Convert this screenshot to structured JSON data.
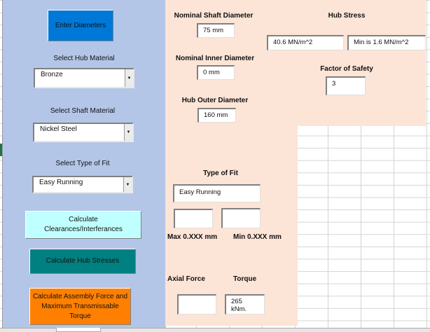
{
  "left_panel": {
    "enter_diameters": "Enter Diameters",
    "hub_material_label": "Select Hub Material",
    "hub_material_value": "Bronze",
    "shaft_material_label": "Select Shaft Material",
    "shaft_material_value": "Nickel Steel",
    "fit_label": "Select Type of Fit",
    "fit_value": "Easy Running",
    "calc_clearances": "Calculate Clearances/Interferances",
    "calc_hub_stresses": "Calculate Hub Stresses",
    "calc_assembly": "Calculate Assembly Force and Maximum Transmissable Torque"
  },
  "results": {
    "shaft_diameter_label": "Nominal Shaft Diameter",
    "shaft_diameter_value": "75 mm",
    "inner_diameter_label": "Nominal Inner Diameter",
    "inner_diameter_value": "0 mm",
    "outer_diameter_label": "Hub Outer Diameter",
    "outer_diameter_value": "160 mm",
    "hub_stress_label": "Hub Stress",
    "hub_stress_value": "40.6 MN/m^2",
    "hub_stress_min": "Min is  1.6 MN/m^2",
    "fos_label": "Factor of Safety",
    "fos_value": "3",
    "fit_label": "Type of Fit",
    "fit_value": "Easy Running",
    "max_label": "Max 0.XXX mm",
    "min_label": "Min 0.XXX mm",
    "axial_label": "Axial Force",
    "torque_label": "Torque",
    "torque_value": "265 kNm."
  },
  "colors": {
    "left_bg": "#b4c6e7",
    "right_bg": "#fce4d6",
    "enter": "#0078d7",
    "clear": "#c0ffff",
    "hub": "#008080",
    "assembly": "#ff8000"
  }
}
